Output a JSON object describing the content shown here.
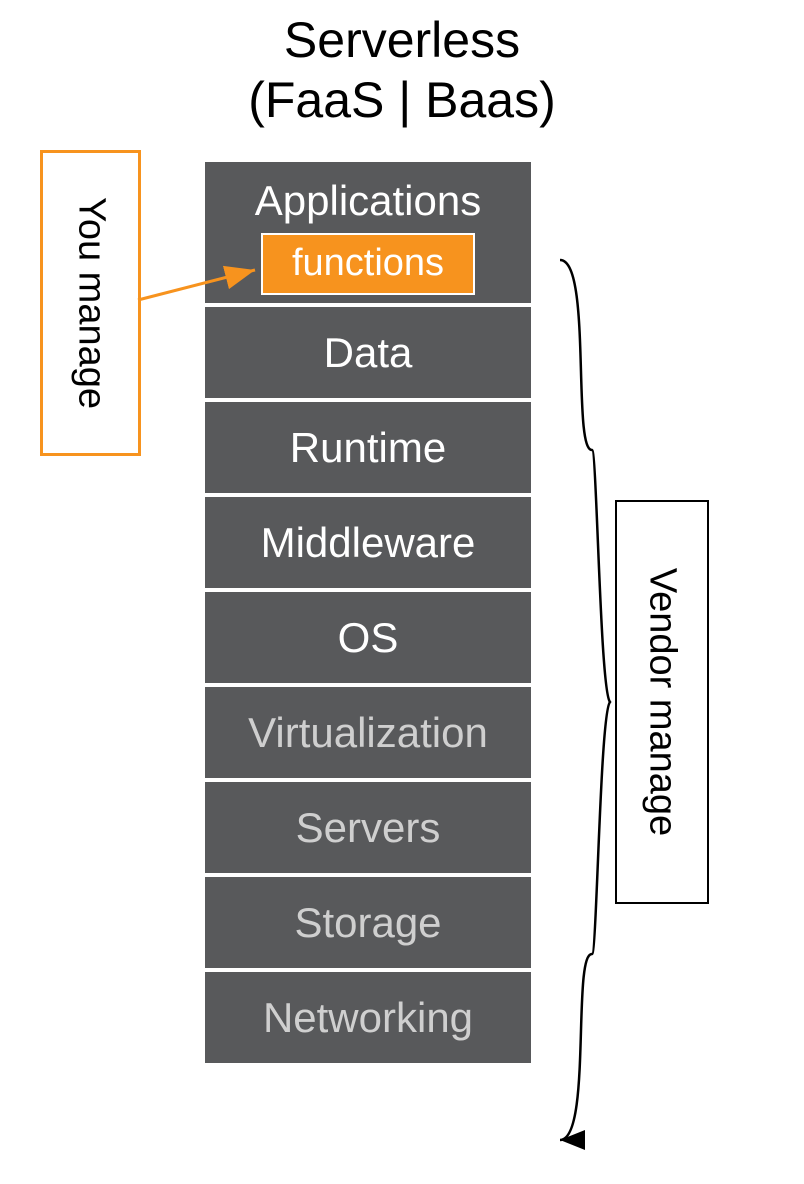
{
  "title_line1": "Serverless",
  "title_line2": "(FaaS | Baas)",
  "you_manage_label": "You manage",
  "vendor_manage_label": "Vendor manage",
  "functions_label": "functions",
  "layers": {
    "l0": "Applications",
    "l1": "Data",
    "l2": "Runtime",
    "l3": "Middleware",
    "l4": "OS",
    "l5": "Virtualization",
    "l6": "Servers",
    "l7": "Storage",
    "l8": "Networking"
  }
}
